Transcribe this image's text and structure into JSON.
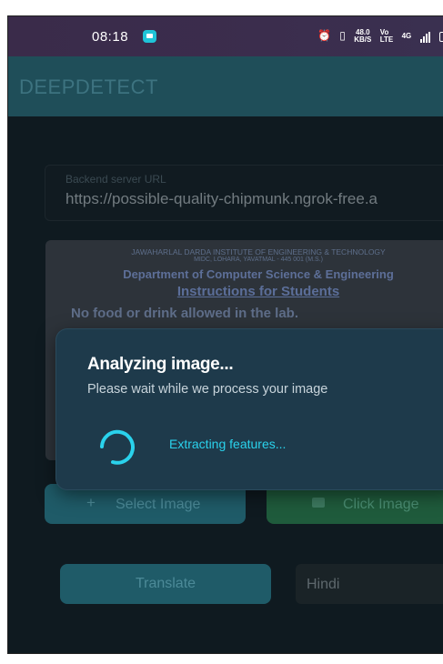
{
  "status_bar": {
    "time": "08:18",
    "icons": [
      "alarm-icon",
      "vibrate-icon",
      "network-speed",
      "volte-icon",
      "4g-signal-icon",
      "battery-icon"
    ],
    "speed_value": "48.0",
    "speed_unit": "KB/S",
    "volte_top": "Vo",
    "volte_bottom": "LTE",
    "net_type": "4G"
  },
  "app_bar": {
    "title": "DEEPDETECT"
  },
  "url_field": {
    "label": "Backend server URL",
    "value": "https://possible-quality-chipmunk.ngrok-free.a"
  },
  "image_preview": {
    "line1": "JAWAHARLAL DARDA INSTITUTE OF ENGINEERING & TECHNOLOGY",
    "line2": "MIDC, LOHARA, YAVATMAL - 445 001 (M.S.)",
    "line3": "Department of Computer Science & Engineering",
    "line4": "Instructions for Students",
    "line5": "No food or drink allowed in the lab."
  },
  "buttons": {
    "select_image_icon": "+",
    "select_image": "Select Image",
    "click_image": "Click Image",
    "translate": "Translate"
  },
  "language_select": {
    "value": "Hindi"
  },
  "overlay": {
    "title": "Analyzing image...",
    "subtitle": "Please wait while we process your image",
    "status": "Extracting features..."
  },
  "colors": {
    "app_bar": "#1f4e59",
    "overlay": "#1e3a4b",
    "accent": "#2ad2ec"
  }
}
